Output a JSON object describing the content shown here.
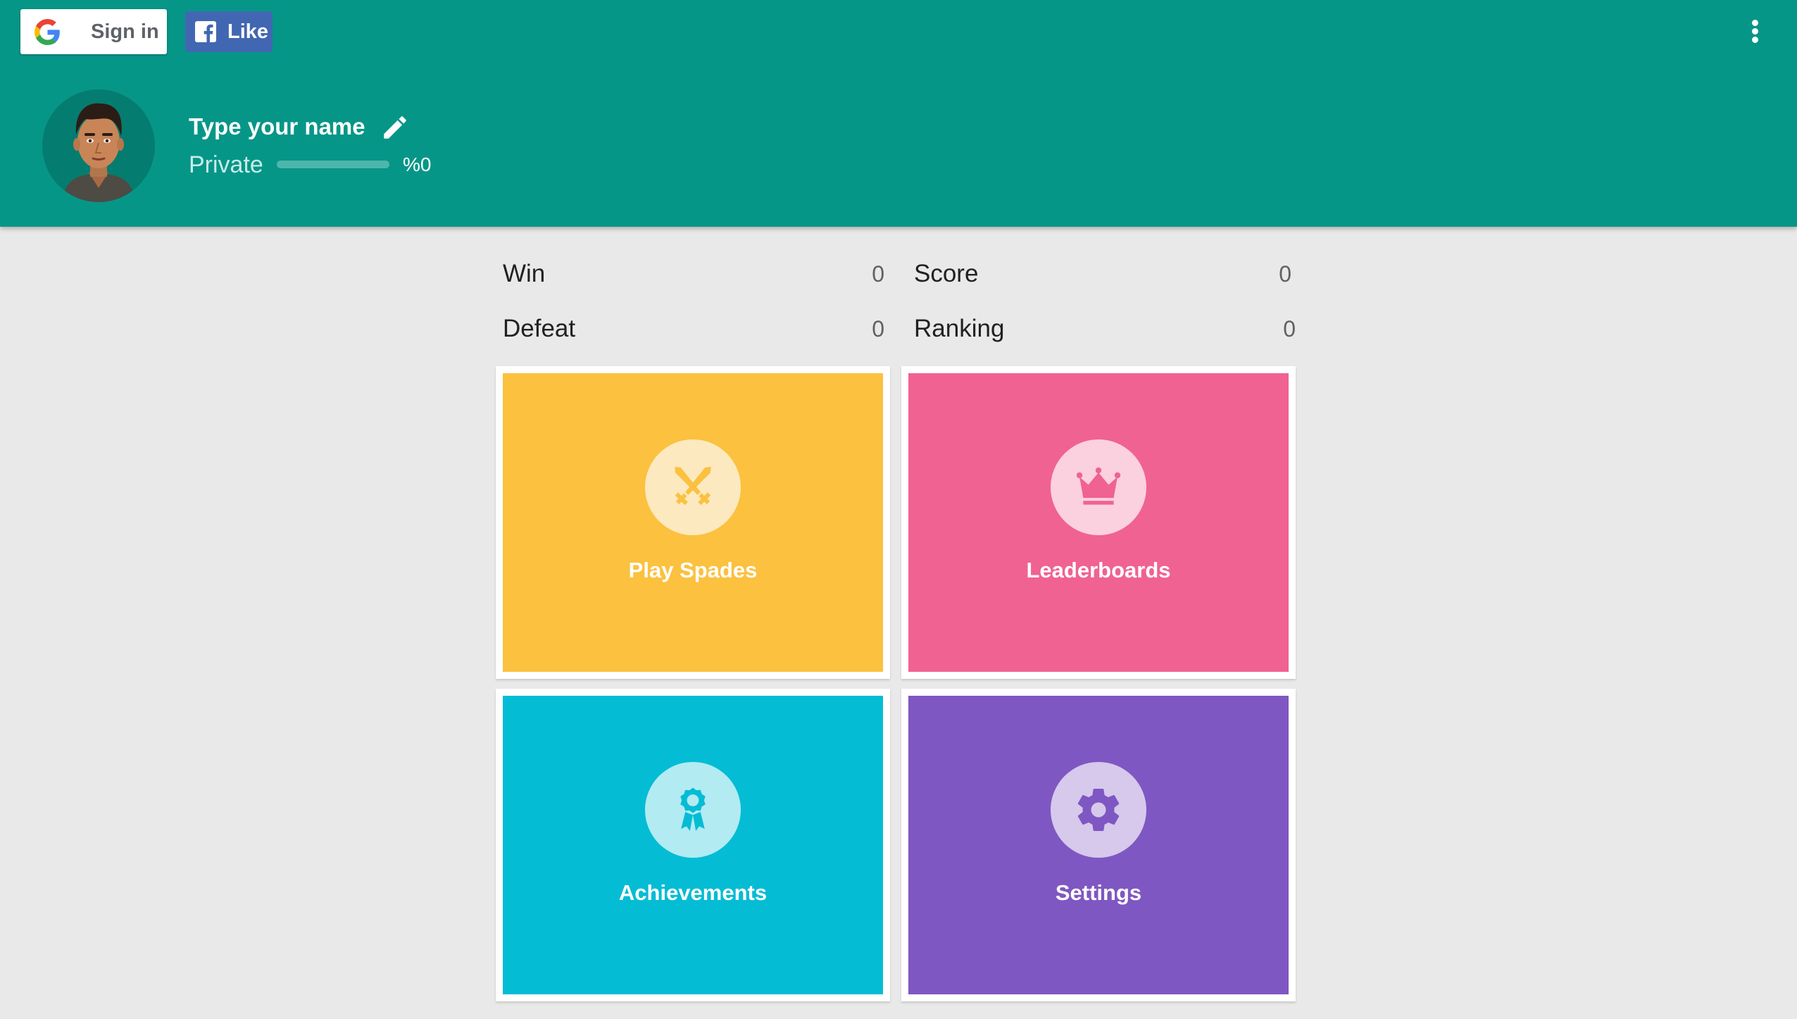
{
  "header": {
    "google_signin_label": "Sign in",
    "facebook_like_label": "Like",
    "player_name": "Type your name",
    "rank_label": "Private",
    "progress_text": "%0",
    "progress_value": 0
  },
  "stats": {
    "win": {
      "label": "Win",
      "value": "0"
    },
    "score": {
      "label": "Score",
      "value": "0"
    },
    "defeat": {
      "label": "Defeat",
      "value": "0"
    },
    "ranking": {
      "label": "Ranking",
      "value": "0"
    }
  },
  "tiles": [
    {
      "label": "Play Spades",
      "icon": "crossed-swords-icon",
      "color": "#fbc13f",
      "icon_bg": "#fde9bf",
      "icon_color": "#fbc13f"
    },
    {
      "label": "Leaderboards",
      "icon": "crown-icon",
      "color": "#f06292",
      "icon_bg": "#fbd0df",
      "icon_color": "#f06292"
    },
    {
      "label": "Achievements",
      "icon": "ribbon-badge-icon",
      "color": "#05bcd5",
      "icon_bg": "#b2ebf2",
      "icon_color": "#05bcd5"
    },
    {
      "label": "Settings",
      "icon": "gear-icon",
      "color": "#7f57c2",
      "icon_bg": "#d6c9ec",
      "icon_color": "#7f57c2"
    }
  ],
  "colors": {
    "header_bg": "#069688",
    "page_bg": "#e9e9e9",
    "facebook_blue": "#4267b2"
  }
}
